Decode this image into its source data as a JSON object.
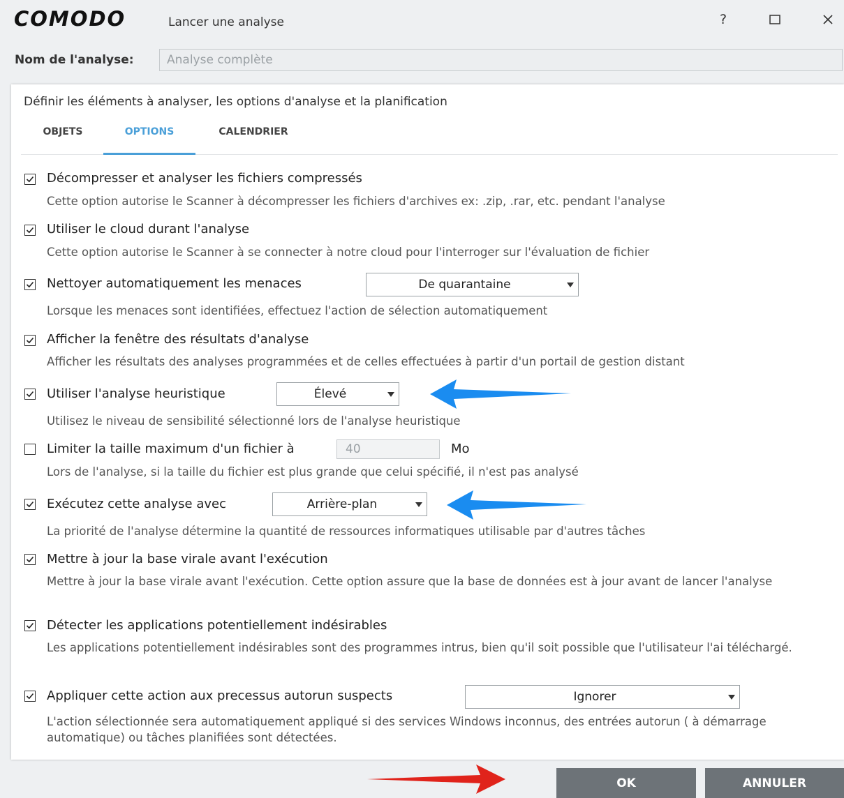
{
  "window": {
    "logo": "COMODO",
    "title": "Lancer une analyse",
    "help_label": "?",
    "maximize_label": "☐",
    "close_label": "✕"
  },
  "scan_name": {
    "label": "Nom de l'analyse:",
    "value": "Analyse complète"
  },
  "panel": {
    "subtitle": "Définir les éléments à analyser, les options d'analyse et la planification",
    "tabs": [
      {
        "label": "OBJETS",
        "active": false
      },
      {
        "label": "OPTIONS",
        "active": true
      },
      {
        "label": "CALENDRIER",
        "active": false
      }
    ]
  },
  "options": [
    {
      "checked": true,
      "label": "Décompresser et analyser les fichiers compressés",
      "desc": "Cette option autorise le Scanner à décompresser les fichiers d'archives ex: .zip, .rar, etc. pendant l'analyse"
    },
    {
      "checked": true,
      "label": "Utiliser le cloud durant l'analyse",
      "desc": "Cette option autorise le Scanner à se connecter à notre cloud pour l'interroger sur l'évaluation de fichier"
    },
    {
      "checked": true,
      "label": "Nettoyer automatiquement les menaces",
      "select": "De quarantaine",
      "desc": "Lorsque les menaces sont identifiées, effectuez l'action de sélection automatiquement"
    },
    {
      "checked": true,
      "label": "Afficher la fenêtre des résultats d'analyse",
      "desc": "Afficher les résultats des analyses programmées et de celles effectuées à partir d'un portail de gestion distant"
    },
    {
      "checked": true,
      "label": "Utiliser l'analyse heuristique",
      "select": "Élevé",
      "desc": "Utilisez le niveau de sensibilité sélectionné lors de l'analyse heuristique"
    },
    {
      "checked": false,
      "label": "Limiter la taille maximum d'un fichier à",
      "input": "40",
      "unit": "Mo",
      "desc": "Lors de l'analyse, si la taille du fichier est plus grande que celui spécifié, il n'est pas analysé"
    },
    {
      "checked": true,
      "label": "Exécutez cette analyse avec",
      "select": "Arrière-plan",
      "desc": "La priorité de l'analyse détermine la quantité de ressources informatiques utilisable par d'autres tâches"
    },
    {
      "checked": true,
      "label": "Mettre à jour la base virale avant l'exécution",
      "desc": "Mettre à jour la base virale avant l'exécution. Cette option assure que la base de données est à jour avant de lancer l'analyse"
    },
    {
      "checked": true,
      "label": "Détecter les applications potentiellement indésirables",
      "desc": "Les applications potentiellement indésirables sont des programmes intrus, bien qu'il soit possible que l'utilisateur l'ai téléchargé."
    },
    {
      "checked": true,
      "label": "Appliquer cette action aux precessus autorun suspects",
      "select": "Ignorer",
      "desc": "L'action sélectionnée sera automatiquement appliqué si des services Windows inconnus, des entrées autorun ( à démarrage automatique) ou tâches planifiées sont détectées."
    }
  ],
  "buttons": {
    "ok": "OK",
    "cancel": "ANNULER"
  },
  "colors": {
    "accent": "#4a9fd8",
    "annotation_blue": "#1a8cf0",
    "annotation_red": "#e0231b",
    "button": "#6d7378"
  }
}
